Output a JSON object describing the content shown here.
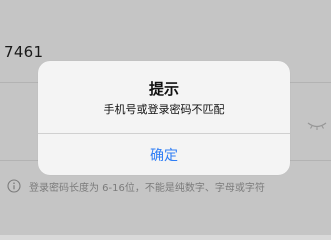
{
  "login": {
    "phone_value": "7461",
    "hint_text": "登录密码长度为 6-16位，不能是纯数字、字母或字符"
  },
  "icons": {
    "password_toggle": "eye-closed-icon",
    "hint": "info-icon"
  },
  "alert": {
    "title": "提示",
    "message": "手机号或登录密码不匹配",
    "confirm_label": "确定"
  },
  "colors": {
    "accent": "#2f7ef5",
    "dialog_bg": "#f4f4f4",
    "background": "#dcdcdc"
  }
}
